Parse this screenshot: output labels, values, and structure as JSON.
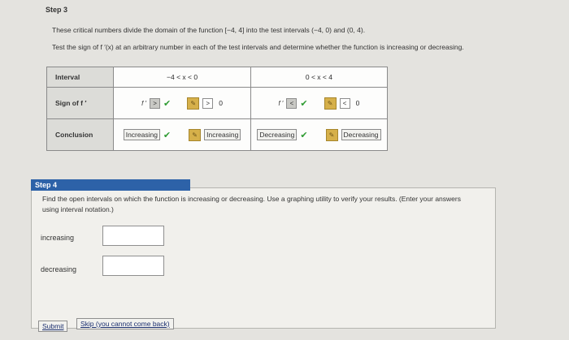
{
  "step3": {
    "label": "Step 3",
    "text1": "These critical numbers divide the domain of the function [−4, 4] into the test intervals (−4, 0) and (0, 4).",
    "text2": "Test the sign of f ′(x) at an arbitrary number in each of the test intervals and determine whether the function is increasing or decreasing."
  },
  "table": {
    "row_headers": [
      "Interval",
      "Sign of f ′",
      "Conclusion"
    ],
    "interval1": "−4 < x < 0",
    "interval2": "0 < x < 4",
    "fprime": "f ′",
    "interval1_sign": {
      "selected": ">",
      "answer_symbol": ">",
      "zero": "0"
    },
    "interval2_sign": {
      "selected": "<",
      "answer_symbol": "<",
      "zero": "0"
    },
    "interval1_conclusion": {
      "selected": "Increasing",
      "answer": "Increasing"
    },
    "interval2_conclusion": {
      "selected": "Decreasing",
      "answer": "Decreasing"
    }
  },
  "step4": {
    "label": "Step 4",
    "text": "Find the open intervals on which the function is increasing or decreasing. Use a graphing utility to verify your results. (Enter your answers using interval notation.)",
    "increasing_label": "increasing",
    "decreasing_label": "decreasing",
    "increasing_value": "",
    "decreasing_value": ""
  },
  "buttons": {
    "submit": "Submit",
    "skip": "Skip (you cannot come back)"
  },
  "colors": {
    "step4_tab": "#2d62a8",
    "check": "#2e9b32",
    "key_icon": "#d6b04a"
  }
}
